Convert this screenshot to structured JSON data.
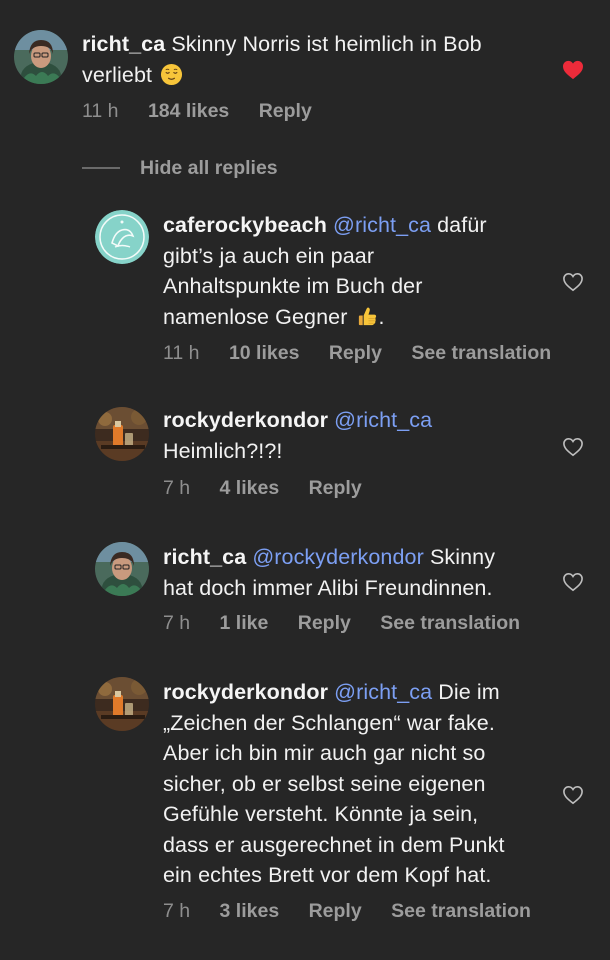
{
  "comment": {
    "username": "richt_ca",
    "text": "Skinny Norris ist heimlich in Bob",
    "text_line2": "verliebt",
    "emoji": "relieved-face-emoji",
    "time": "11 h",
    "likes": "184 likes",
    "reply": "Reply",
    "liked": true
  },
  "hide_replies": "Hide all replies",
  "replies": [
    {
      "username": "caferockybeach",
      "mention": "@richt_ca",
      "line1_rest": "dafür",
      "line2": "gibt’s ja auch ein paar",
      "line3": "Anhaltspunkte im Buch der",
      "line4": "namenlose Gegner",
      "line4_after_emoji": ".",
      "emoji": "thumbs-up-emoji",
      "time": "11 h",
      "likes": "10 likes",
      "reply": "Reply",
      "translate": "See translation"
    },
    {
      "username": "rockyderkondor",
      "mention": "@richt_ca",
      "line2": "Heimlich?!?!",
      "time": "7 h",
      "likes": "4 likes",
      "reply": "Reply"
    },
    {
      "username": "richt_ca",
      "mention": "@rockyderkondor",
      "line1_rest": "Skinny",
      "line2": "hat doch immer Alibi Freundinnen.",
      "time": "7 h",
      "likes": "1 like",
      "reply": "Reply",
      "translate": "See translation"
    },
    {
      "username": "rockyderkondor",
      "mention": "@richt_ca",
      "line1_rest": "Die im",
      "line2": "„Zeichen der Schlangen“ war fake.",
      "line3": "Aber ich bin mir auch gar nicht so",
      "line4": "sicher, ob er selbst seine eigenen",
      "line5": "Gefühle versteht. Könnte ja sein,",
      "line6": "dass er ausgerechnet in dem Punkt",
      "line7": "ein echtes Brett vor dem Kopf hat.",
      "time": "7 h",
      "likes": "3 likes",
      "reply": "Reply",
      "translate": "See translation"
    }
  ],
  "colors": {
    "background": "#262626",
    "mention": "#7c9ff3",
    "heart_liked": "#ed2b3a",
    "meta_text": "#9c9c9c"
  }
}
